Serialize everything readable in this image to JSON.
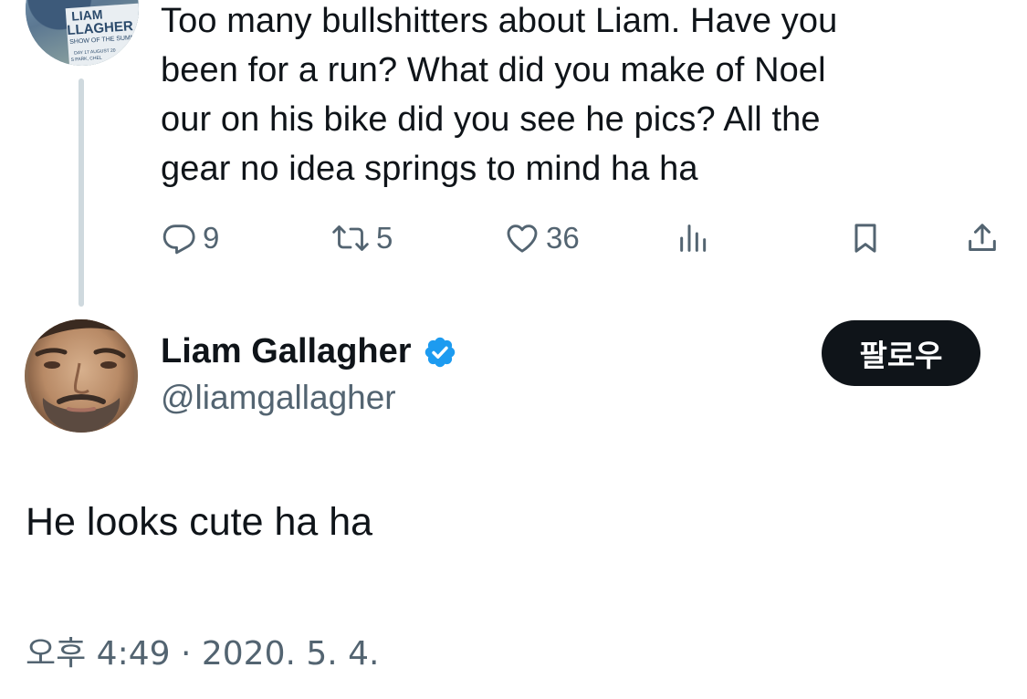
{
  "parent_tweet": {
    "avatar_text": {
      "line1": "LIAM",
      "line2": "LLAGHER",
      "line3": "SHOW OF THE SUMMER",
      "line4": "DAY 17 AUGUST 20",
      "line5": "S PARK, CHEL"
    },
    "text_lines": [
      "Too many bullshitters about Liam. Have you",
      "been for a run? What did you make of Noel",
      "our on his bike did you see he pics? All the",
      "gear no idea springs to mind ha ha"
    ],
    "replies": "9",
    "retweets": "5",
    "likes": "36"
  },
  "main_tweet": {
    "display_name": "Liam Gallagher",
    "handle": "@liamgallagher",
    "follow_label": "팔로우",
    "text": "He looks cute ha ha",
    "timestamp": "오후 4:49 · 2020. 5. 4."
  },
  "icons": {
    "reply": "reply-icon",
    "retweet": "retweet-icon",
    "like": "heart-icon",
    "views": "analytics-icon",
    "bookmark": "bookmark-icon",
    "share": "share-icon",
    "verified": "verified-badge-icon"
  },
  "colors": {
    "text_primary": "#0f1419",
    "text_secondary": "#536471",
    "verified_blue": "#1d9bf0",
    "thread_line": "#cfd9de",
    "follow_button_bg": "#0f1419"
  }
}
